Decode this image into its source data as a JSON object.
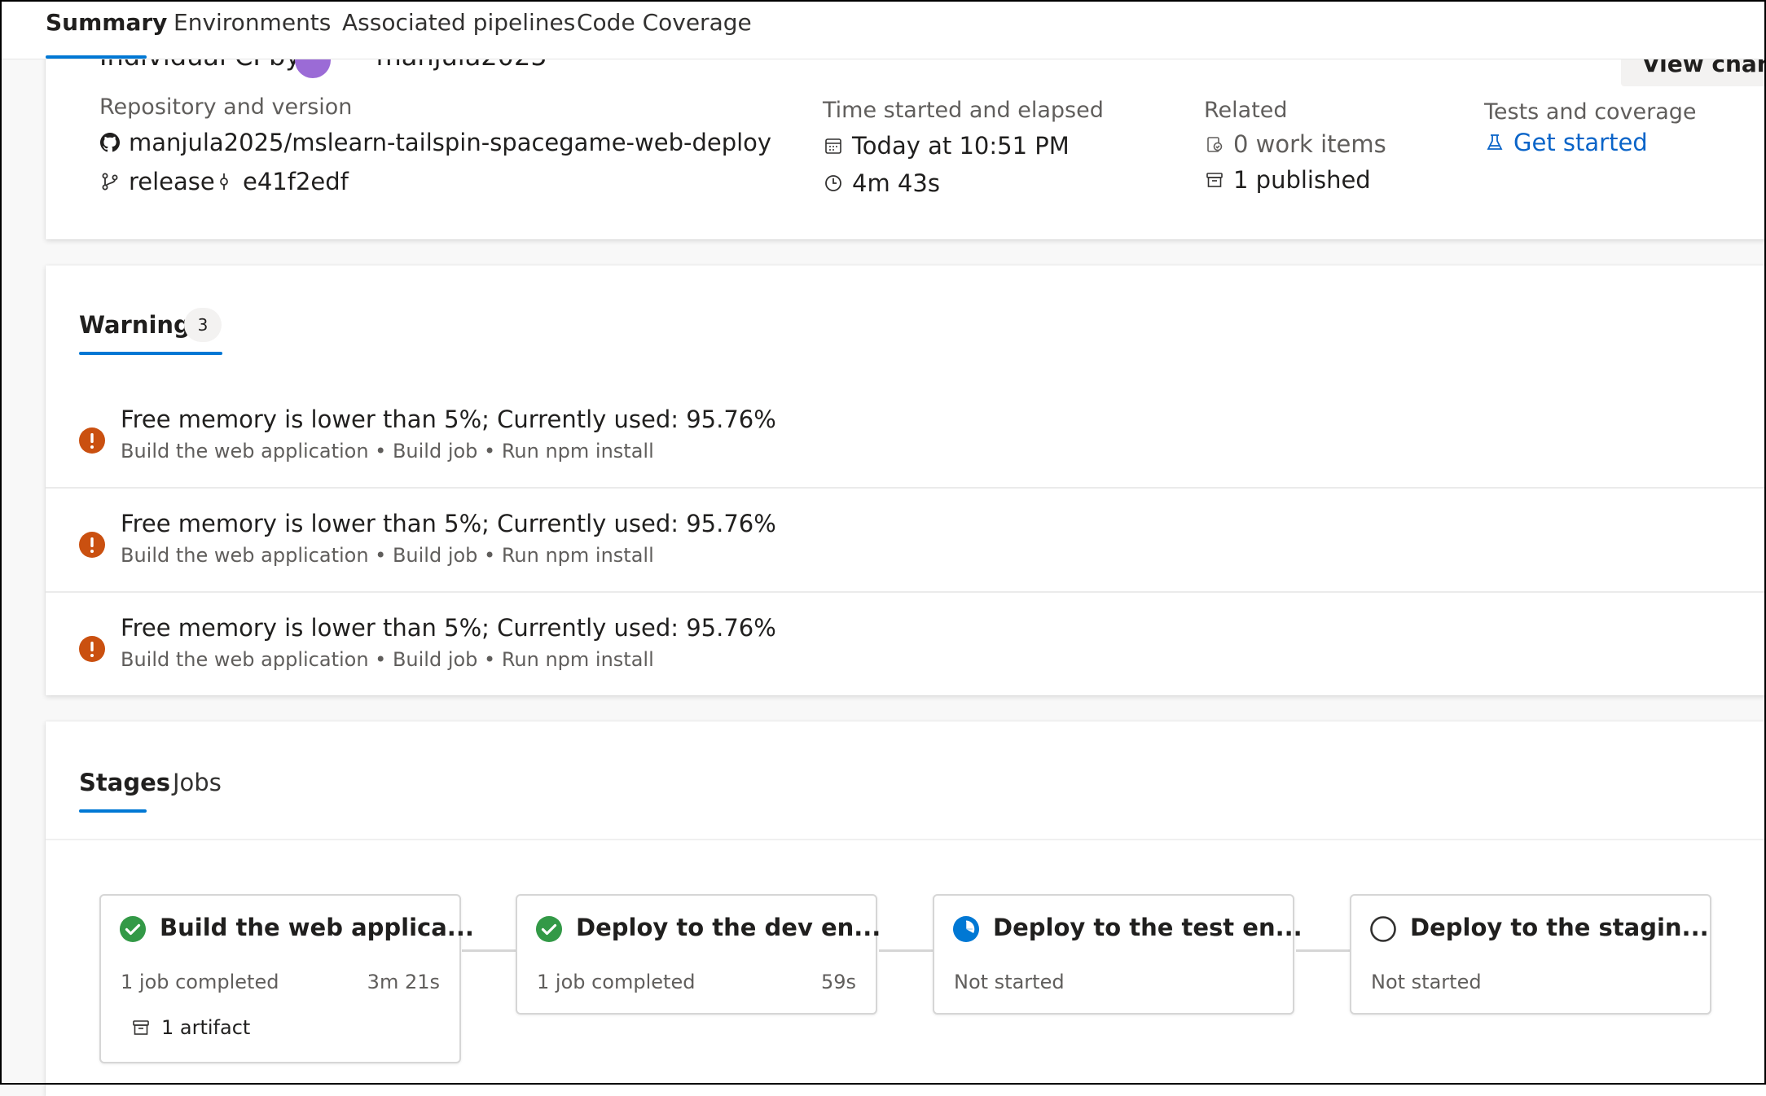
{
  "tabs": [
    {
      "label": "Summary",
      "active": true
    },
    {
      "label": "Environments",
      "active": false
    },
    {
      "label": "Associated pipelines",
      "active": false
    },
    {
      "label": "Code Coverage",
      "active": false
    }
  ],
  "run": {
    "title_partial": "Individual CI by",
    "user": "manjula2025",
    "view_changes": "View change",
    "repo_label": "Repository and version",
    "repo": "manjula2025/mslearn-tailspin-spacegame-web-deploy",
    "branch": "release",
    "commit": "e41f2edf",
    "time_label": "Time started and elapsed",
    "started": "Today at 10:51 PM",
    "elapsed": "4m 43s",
    "related_label": "Related",
    "work_items": "0 work items",
    "published": "1 published",
    "tests_label": "Tests and coverage",
    "tests_link": "Get started"
  },
  "warnings": {
    "tab_label": "Warnings",
    "count": "3",
    "items": [
      {
        "message": "Free memory is lower than 5%; Currently used: 95.76%",
        "path": "Build the web application • Build job • Run npm install"
      },
      {
        "message": "Free memory is lower than 5%; Currently used: 95.76%",
        "path": "Build the web application • Build job • Run npm install"
      },
      {
        "message": "Free memory is lower than 5%; Currently used: 95.76%",
        "path": "Build the web application • Build job • Run npm install"
      }
    ]
  },
  "stages_section": {
    "tabs": [
      {
        "label": "Stages",
        "active": true
      },
      {
        "label": "Jobs",
        "active": false
      }
    ],
    "stages": [
      {
        "title": "Build the web applica...",
        "status": "succeeded",
        "icon": "success-check-icon",
        "summary": "1 job completed",
        "duration": "3m 21s",
        "artifact": "1 artifact"
      },
      {
        "title": "Deploy to the dev en...",
        "status": "succeeded",
        "icon": "success-check-icon",
        "summary": "1 job completed",
        "duration": "59s"
      },
      {
        "title": "Deploy to the test en...",
        "status": "waiting",
        "icon": "clock-waiting-icon",
        "summary": "Not started"
      },
      {
        "title": "Deploy to the stagin...",
        "status": "not-started",
        "icon": "empty-circle-icon",
        "summary": "Not started"
      }
    ]
  },
  "colors": {
    "accent": "#0078d4",
    "success": "#339947",
    "warning": "#ca5010",
    "link": "#0a64c8"
  }
}
